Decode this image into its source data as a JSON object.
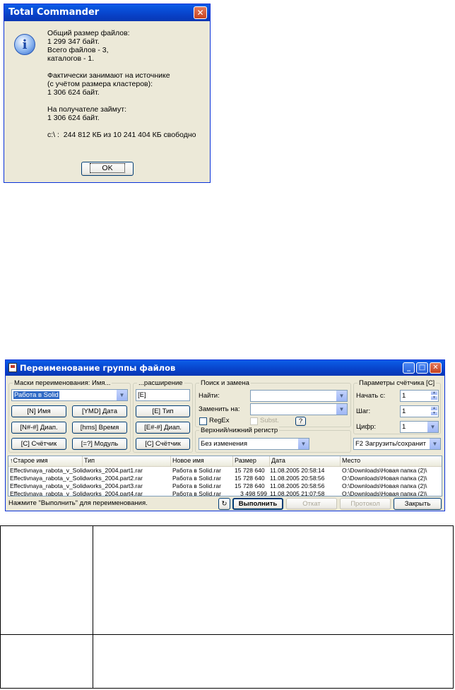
{
  "info_dialog": {
    "title": "Total Commander",
    "icon": "info-icon",
    "message_lines": [
      "Общий размер файлов:",
      "1 299 347 байт.",
      "Всего файлов - 3,",
      "каталогов - 1.",
      "",
      "Фактически занимают на источнике",
      "(с учётом размера кластеров):",
      "1 306 624 байт.",
      "",
      "На получателе займут:",
      "1 306 624 байт.",
      "",
      "c:\\ :  244 812 КБ из 10 241 404 КБ свободно"
    ],
    "ok_label": "OK"
  },
  "rename_dialog": {
    "title": "Переименование группы файлов",
    "masks_group": {
      "title": "Маски переименования: Имя...",
      "name_combo_value": "Работа в Solid",
      "buttons": [
        "[N] Имя",
        "[YMD] Дата",
        "[N#-#] Диап.",
        "[hms] Время",
        "[C] Счётчик",
        "[=?] Модуль"
      ]
    },
    "ext_group": {
      "title": "...расширение",
      "ext_value": "[E]",
      "buttons": [
        "[E] Тип",
        "[E#-#] Диап.",
        "[C] Счётчик"
      ]
    },
    "search_group": {
      "title": "Поиск и замена",
      "find_label": "Найти:",
      "replace_label": "Заменить на:",
      "regex_label": "RegEx",
      "subst_label": "Subst.",
      "help_label": "?"
    },
    "case_group": {
      "title": "Верхний/нижний регистр",
      "value": "Без изменения"
    },
    "counter_group": {
      "title": "Параметры счётчика [C]",
      "start_label": "Начать с:",
      "start_value": "1",
      "step_label": "Шаг:",
      "step_value": "1",
      "digits_label": "Цифр:",
      "digits_value": "1"
    },
    "load_save_combo": "F2 Загрузить/сохранит",
    "columns": [
      "↑Старое имя",
      "Тип",
      "Новое имя",
      "Размер",
      "Дата",
      "Место"
    ],
    "rows": [
      {
        "old": "Effectivnaya_rabota_v_Solidworks_2004.part1.rar",
        "new": "Работа в Solid.rar",
        "size": "15 728 640",
        "date": "11.08.2005 20:58:14",
        "place": "O:\\Downloads\\Новая папка (2)\\"
      },
      {
        "old": "Effectivnaya_rabota_v_Solidworks_2004.part2.rar",
        "new": "Работа в Solid.rar",
        "size": "15 728 640",
        "date": "11.08.2005 20:58:56",
        "place": "O:\\Downloads\\Новая папка (2)\\"
      },
      {
        "old": "Effectivnaya_rabota_v_Solidworks_2004.part3.rar",
        "new": "Работа в Solid.rar",
        "size": "15 728 640",
        "date": "11.08.2005 20:58:56",
        "place": "O:\\Downloads\\Новая папка (2)\\"
      },
      {
        "old": "Effectivnaya_rabota_v_Solidworks_2004.part4.rar",
        "new": "Работа в Solid.rar",
        "size": "3 498 599",
        "date": "11.08.2005 21:07:58",
        "place": "O:\\Downloads\\Новая папка (2)\\"
      }
    ],
    "status_text": "Нажмите \"Выполнить\" для переименования.",
    "run_label": "Выполнить",
    "undo_label": "Откат",
    "log_label": "Протокол",
    "close_label": "Закрыть"
  },
  "colors": {
    "titlebar": "#0842c9",
    "dialog_bg": "#ece9d8",
    "selection": "#316ac5"
  }
}
